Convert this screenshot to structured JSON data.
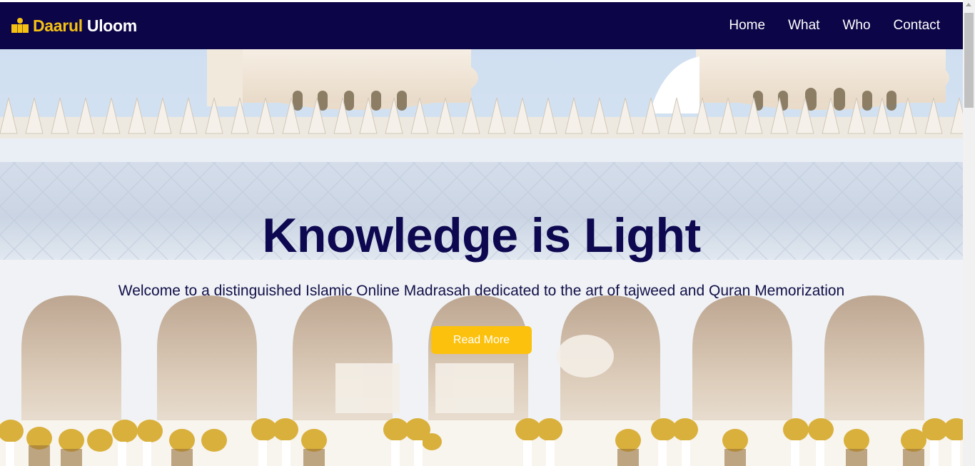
{
  "brand": {
    "name_part1": "Daarul",
    "name_part2": "Uloom",
    "icon": "people-icon"
  },
  "nav": {
    "items": [
      "Home",
      "What",
      "Who",
      "Contact"
    ]
  },
  "hero": {
    "title": "Knowledge is Light",
    "subtitle": "Welcome to a distinguished Islamic Online Madrasah dedicated to the art of tajweed and Quran Memorization",
    "button_label": "Read More",
    "background": "mosque-arches-photo"
  },
  "colors": {
    "navbar_bg": "#0c0548",
    "brand_accent": "#f5c112",
    "title": "#0d0850",
    "button_bg": "#fcc10d"
  }
}
